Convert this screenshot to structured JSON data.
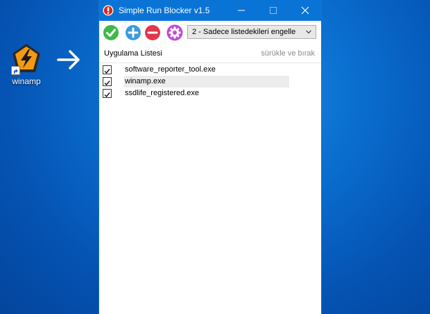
{
  "desktop": {
    "icon_label": "winamp",
    "arrow_icon": "arrow-right-icon"
  },
  "window": {
    "title": "Simple Run Blocker v1.5",
    "accent": "#0a74d6",
    "toolbar": {
      "buttons": [
        "check-icon",
        "plus-icon",
        "minus-icon",
        "settings-icon"
      ],
      "mode_selected": "2 - Sadece listedekileri engelle"
    },
    "list": {
      "header_left": "Uygulama Listesi",
      "header_right": "sürükle ve bırak",
      "items": [
        {
          "name": "software_reporter_tool.exe",
          "checked": true
        },
        {
          "name": "winamp.exe",
          "checked": true
        },
        {
          "name": "ssdlife_registered.exe",
          "checked": true
        }
      ]
    }
  }
}
